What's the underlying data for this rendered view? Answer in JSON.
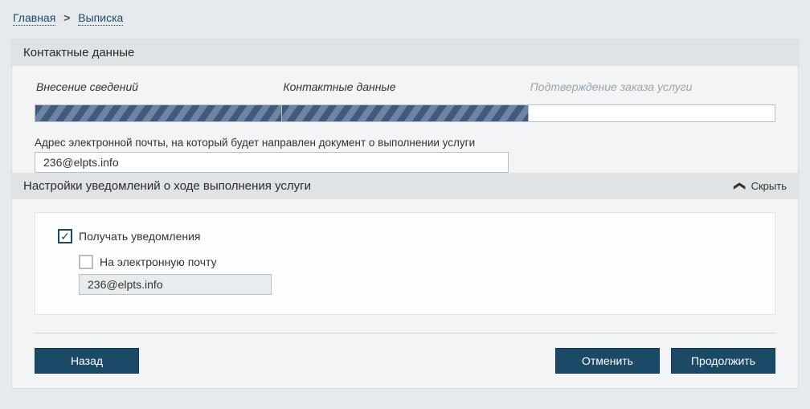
{
  "breadcrumb": {
    "home": "Главная",
    "current": "Выписка"
  },
  "card_title": "Контактные данные",
  "steps": {
    "s1": "Внесение сведений",
    "s2": "Контактные данные",
    "s3": "Подтверждение заказа услуги"
  },
  "email_label": "Адрес электронной почты, на который будет направлен документ о выполнении услуги",
  "email_value": "236@elpts.info",
  "section_title": "Настройки уведомлений о ходе выполнения услуги",
  "toggle_label": "Скрыть",
  "receive_notifications_label": "Получать уведомления",
  "to_email_label": "На электронную почту",
  "notify_email_value": "236@elpts.info",
  "buttons": {
    "back": "Назад",
    "cancel": "Отменить",
    "next": "Продолжить"
  }
}
